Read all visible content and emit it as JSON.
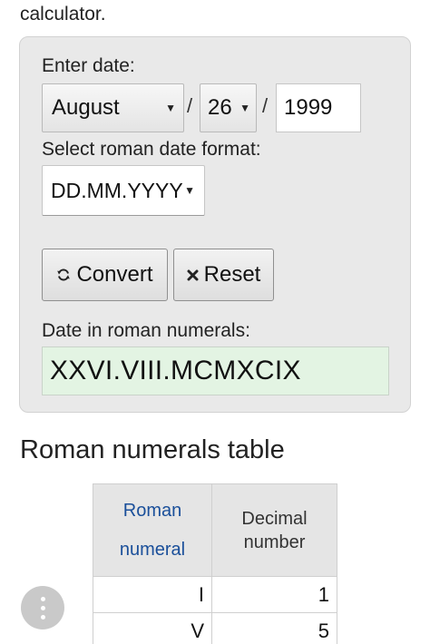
{
  "intro_text": "calculator.",
  "form": {
    "date_label": "Enter date:",
    "month_value": "August",
    "separator": "/",
    "day_value": "26",
    "year_value": "1999",
    "format_label": "Select roman date format:",
    "format_value": "DD.MM.YYYY",
    "convert_label": "Convert",
    "reset_label": "Reset",
    "result_label": "Date in roman numerals:",
    "result_value": "XXVI.VIII.MCMXCIX"
  },
  "table": {
    "heading": "Roman numerals table",
    "col1_line1": "Roman",
    "col1_line2": "numeral",
    "col2_line1": "Decimal",
    "col2_line2": "number",
    "rows": [
      {
        "roman": "I",
        "decimal": "1"
      },
      {
        "roman": "V",
        "decimal": "5"
      }
    ]
  },
  "icons": {
    "convert": "refresh-icon",
    "reset": "close-icon",
    "fab": "more-vertical-icon",
    "dropdown": "caret-down-icon"
  },
  "colors": {
    "panel_bg": "#e9e9e9",
    "result_bg": "#e3f4e3",
    "table_header_link": "#1a4f9a"
  }
}
